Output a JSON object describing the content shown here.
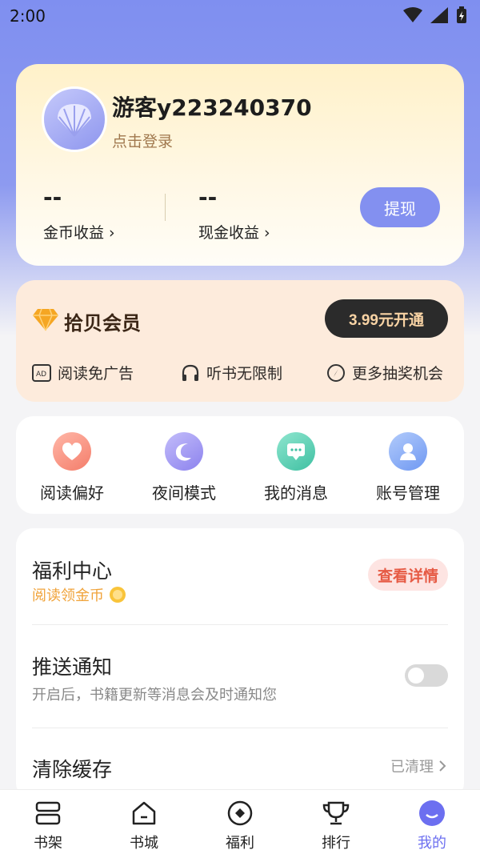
{
  "status_bar": {
    "time": "2:00"
  },
  "user": {
    "name": "游客y223240370",
    "login_link": "点击登录",
    "coin_value": "--",
    "coin_label": "金币收益",
    "cash_value": "--",
    "cash_label": "现金收益",
    "withdraw_label": "提现"
  },
  "vip": {
    "title": "拾贝会员",
    "button_label": "3.99元开通",
    "benefits": [
      "阅读免广告",
      "听书无限制",
      "更多抽奖机会"
    ]
  },
  "quick_actions": [
    {
      "label": "阅读偏好",
      "icon": "heart-icon"
    },
    {
      "label": "夜间模式",
      "icon": "moon-icon"
    },
    {
      "label": "我的消息",
      "icon": "message-icon"
    },
    {
      "label": "账号管理",
      "icon": "account-icon"
    }
  ],
  "settings": {
    "welfare_title": "福利中心",
    "welfare_sub": "阅读领金币",
    "welfare_button": "查看详情",
    "push_title": "推送通知",
    "push_sub": "开启后，书籍更新等消息会及时通知您",
    "push_enabled": false,
    "cache_title": "清除缓存",
    "cache_status": "已清理"
  },
  "bottom_nav": [
    {
      "label": "书架",
      "icon": "bookshelf-icon"
    },
    {
      "label": "书城",
      "icon": "bookstore-icon"
    },
    {
      "label": "福利",
      "icon": "welfare-icon"
    },
    {
      "label": "排行",
      "icon": "trophy-icon"
    },
    {
      "label": "我的",
      "icon": "profile-icon",
      "active": true
    }
  ],
  "colors": {
    "accent": "#8390f0",
    "vip_bg": "#fdebdc",
    "nav_active": "#6c6ff0"
  }
}
